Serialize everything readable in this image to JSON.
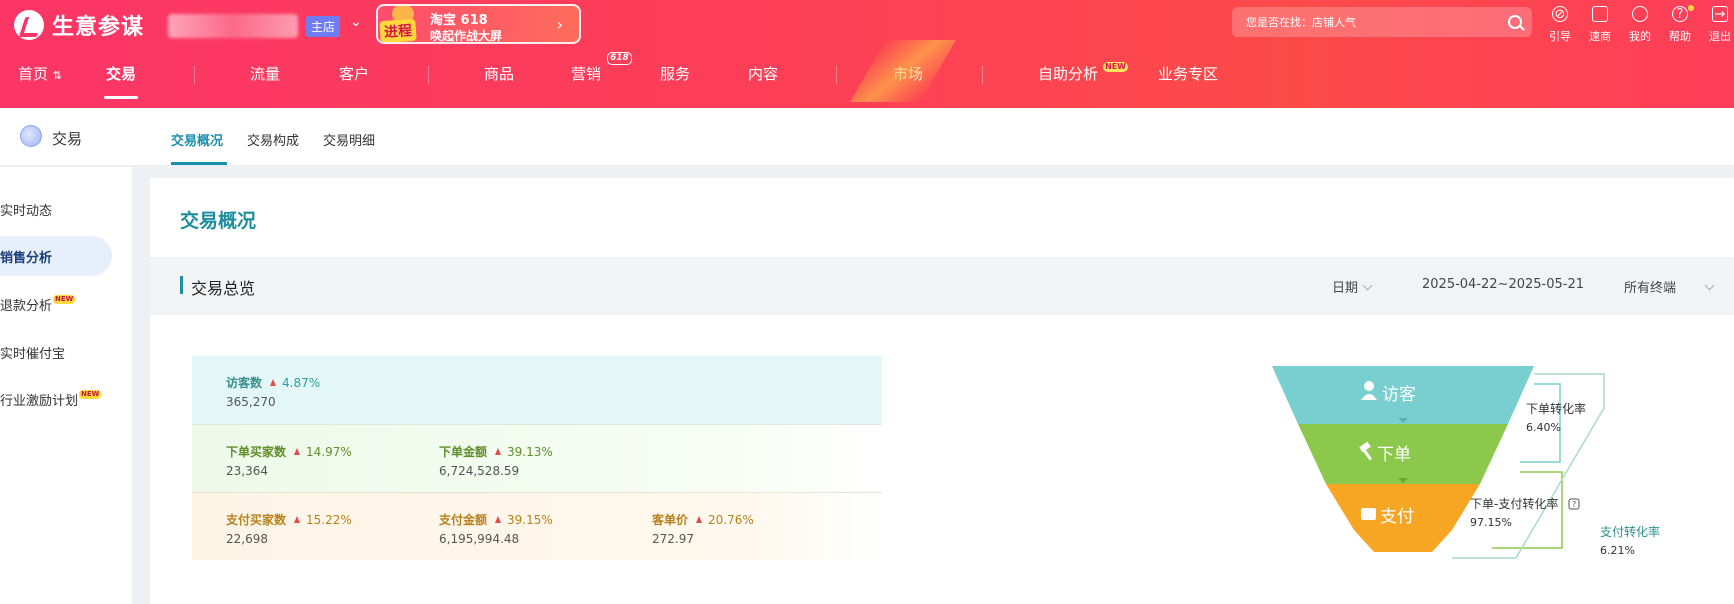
{
  "app": {
    "logo_text": "生意参谋",
    "store_badge": "主店",
    "promo_badge": "进程",
    "promo_line1": "淘宝 618",
    "promo_line2": "唤起作战大屏"
  },
  "search": {
    "placeholder": "您是否在找：店铺人气"
  },
  "header_icons": [
    {
      "label": "引导",
      "icon": "compass-icon"
    },
    {
      "label": "速商",
      "icon": "shop-icon"
    },
    {
      "label": "我的",
      "icon": "user-icon"
    },
    {
      "label": "帮助",
      "icon": "help-icon"
    },
    {
      "label": "退出",
      "icon": "logout-icon"
    }
  ],
  "nav": {
    "items": [
      "首页",
      "交易",
      "流量",
      "客户",
      "商品",
      "营销",
      "服务",
      "内容",
      "市场",
      "自助分析",
      "业务专区"
    ],
    "home_suffix": "⇅",
    "marketing_tag": "618",
    "new_tag": "NEW",
    "active": "交易"
  },
  "section": {
    "label": "交易"
  },
  "tabs": [
    "交易概况",
    "交易构成",
    "交易明细"
  ],
  "sidebar": {
    "items": [
      "实时动态",
      "销售分析",
      "退款分析",
      "实时催付宝",
      "行业激励计划"
    ],
    "active": "销售分析",
    "new_tag": "NEW"
  },
  "main": {
    "title": "交易概况",
    "overview_title": "交易总览",
    "filters": {
      "date_label": "日期",
      "date_range": "2025-04-22~2025-05-21",
      "terminal": "所有终端"
    }
  },
  "metrics": {
    "visitors": {
      "name": "访客数",
      "change": "4.87%",
      "value": "365,270"
    },
    "order_buyers": {
      "name": "下单买家数",
      "change": "14.97%",
      "value": "23,364"
    },
    "order_amount": {
      "name": "下单金额",
      "change": "39.13%",
      "value": "6,724,528.59"
    },
    "pay_buyers": {
      "name": "支付买家数",
      "change": "15.22%",
      "value": "22,698"
    },
    "pay_amount": {
      "name": "支付金额",
      "change": "39.15%",
      "value": "6,195,994.48"
    },
    "avg_price": {
      "name": "客单价",
      "change": "20.76%",
      "value": "272.97"
    }
  },
  "funnel": {
    "stage1": "访客",
    "stage2": "下单",
    "stage3": "支付",
    "rate1_label": "下单转化率",
    "rate1_value": "6.40%",
    "rate2_label": "下单-支付转化率",
    "rate2_value": "97.15%",
    "rate3_label": "支付转化率",
    "rate3_value": "6.21%",
    "colors": {
      "visitor": "#79cfcf",
      "order": "#8cc84b",
      "pay": "#f6a623"
    }
  }
}
